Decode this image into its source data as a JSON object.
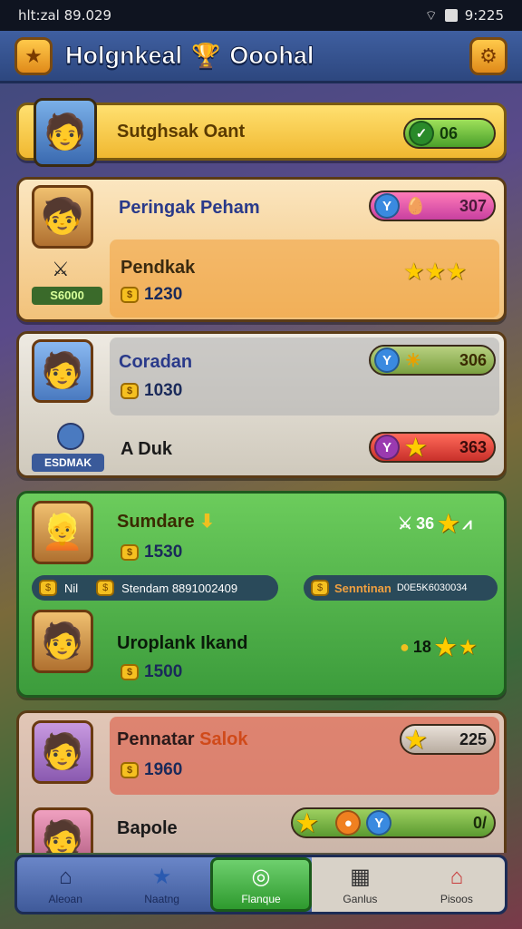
{
  "status": {
    "time": "hlt:zal 89.029",
    "battery": "9:225"
  },
  "header": {
    "title": "Holgnkeal",
    "subtitle": "Ooohal",
    "left_icon": "star-icon",
    "right_icon": "gear-icon"
  },
  "banner": {
    "name": "Sutghsak Oant",
    "pill": "06"
  },
  "cards": [
    {
      "name": "Peringak Peham",
      "badge": "S6000",
      "pill": "307",
      "sub": "Pendkak",
      "value": "1230"
    },
    {
      "name": "Coradan",
      "value": "1030",
      "pill": "306",
      "sub": "A Duk",
      "badge": "ESDMAK",
      "pill2": "363"
    },
    {
      "name": "Sumdare",
      "value": "1530",
      "pill": "36",
      "strip_left_a": "Nil",
      "strip_left_b": "Stendam 8891002409",
      "strip_right_a": "Senntinan",
      "strip_right_b": "D0E5K6030034",
      "name2": "Uroplank Ikand",
      "pill2": "18",
      "value2": "1500"
    },
    {
      "name": "Pennatar",
      "name_accent": "Salok",
      "pill": "225",
      "value": "1960",
      "name2": "Bapole",
      "pill2": "0/"
    }
  ],
  "nav": [
    {
      "label": "Aleoan",
      "icon": "house-icon"
    },
    {
      "label": "Naatng",
      "icon": "star-icon"
    },
    {
      "label": "Flanque",
      "icon": "ring-icon"
    },
    {
      "label": "Ganlus",
      "icon": "box-icon"
    },
    {
      "label": "Pisoos",
      "icon": "barn-icon"
    }
  ],
  "colors": {
    "header": "#3f5fa0",
    "banner": "#f4c640",
    "card_orange": "#f0b458",
    "card_gray": "#dcd8cc",
    "card_green": "#4fb04f",
    "card_pink": "#d88a78",
    "nav_active": "#2e9a2e"
  }
}
